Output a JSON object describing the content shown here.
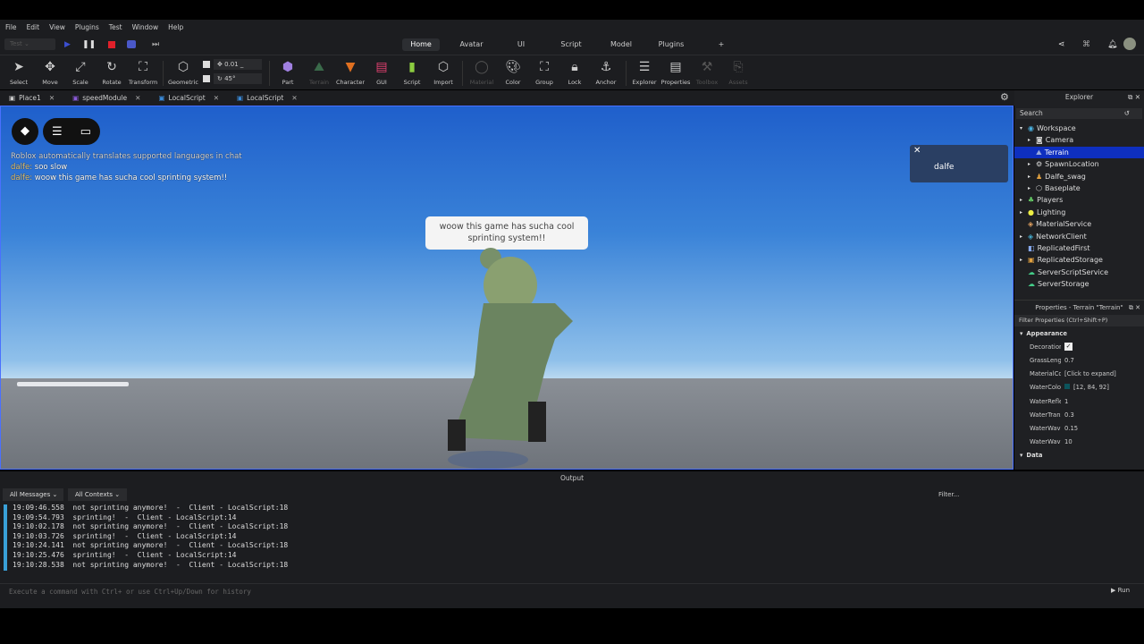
{
  "menu": [
    "File",
    "Edit",
    "View",
    "Plugins",
    "Test",
    "Window",
    "Help"
  ],
  "test_select": "Test",
  "top_tabs": [
    {
      "label": "Home",
      "active": true
    },
    {
      "label": "Avatar"
    },
    {
      "label": "UI"
    },
    {
      "label": "Script"
    },
    {
      "label": "Model"
    },
    {
      "label": "Plugins"
    },
    {
      "label": "+"
    }
  ],
  "ribbon": {
    "select": "Select",
    "move": "Move",
    "scale": "Scale",
    "rotate": "Rotate",
    "transform": "Transform",
    "geometric": "Geometric",
    "move_step": "0.01 _",
    "rotate_step": "45°",
    "part": "Part",
    "terrain": "Terrain",
    "character": "Character",
    "gui": "GUI",
    "script": "Script",
    "import": "Import",
    "material": "Material",
    "color": "Color",
    "group": "Group",
    "lock": "Lock",
    "anchor": "Anchor",
    "explorer": "Explorer",
    "properties": "Properties",
    "toolbox": "Toolbox",
    "assets": "Assets"
  },
  "doc_tabs": [
    "Place1",
    "speedModule",
    "LocalScript",
    "LocalScript"
  ],
  "viewport": {
    "chat": {
      "system": "Roblox automatically translates supported languages in chat",
      "messages": [
        {
          "user": "dalfe:",
          "text": "soo slow"
        },
        {
          "user": "dalfe:",
          "text": "woow this game has sucha cool sprinting system!!"
        }
      ]
    },
    "bubble": "woow this game has sucha cool sprinting system!!",
    "player_popup": "dalfe"
  },
  "explorer": {
    "title": "Explorer",
    "search_placeholder": "Search",
    "items": [
      {
        "label": "Workspace",
        "depth": 0,
        "icon": "globe-icon"
      },
      {
        "label": "Camera",
        "depth": 1,
        "icon": "camera-icon"
      },
      {
        "label": "Terrain",
        "depth": 1,
        "icon": "terrain-icon",
        "selected": true
      },
      {
        "label": "SpawnLocation",
        "depth": 1,
        "icon": "gear-icon"
      },
      {
        "label": "Dalfe_swag",
        "depth": 1,
        "icon": "model-icon"
      },
      {
        "label": "Baseplate",
        "depth": 1,
        "icon": "part-icon"
      },
      {
        "label": "Players",
        "depth": 0,
        "icon": "players-icon"
      },
      {
        "label": "Lighting",
        "depth": 0,
        "icon": "bulb-icon"
      },
      {
        "label": "MaterialService",
        "depth": 0,
        "icon": "service-icon"
      },
      {
        "label": "NetworkClient",
        "depth": 0,
        "icon": "network-icon"
      },
      {
        "label": "ReplicatedFirst",
        "depth": 0,
        "icon": "replicated-icon"
      },
      {
        "label": "ReplicatedStorage",
        "depth": 0,
        "icon": "storage-icon"
      },
      {
        "label": "ServerScriptService",
        "depth": 0,
        "icon": "server-icon"
      },
      {
        "label": "ServerStorage",
        "depth": 0,
        "icon": "server-icon"
      }
    ]
  },
  "properties": {
    "title": "Properties - Terrain \"Terrain\"",
    "filter": "Filter Properties (Ctrl+Shift+P)",
    "section": "Appearance",
    "section2": "Data",
    "rows": [
      {
        "name": "Decoration",
        "value": "",
        "checkbox": true
      },
      {
        "name": "GrassLength",
        "value": "0.7"
      },
      {
        "name": "MaterialCol...",
        "value": "[Click to expand]"
      },
      {
        "name": "WaterColor",
        "value": "[12, 84, 92]",
        "swatch": "#0c545c"
      },
      {
        "name": "WaterRefle...",
        "value": "1"
      },
      {
        "name": "WaterTrans...",
        "value": "0.3"
      },
      {
        "name": "WaterWave...",
        "value": "0.15"
      },
      {
        "name": "WaterWave...",
        "value": "10"
      }
    ]
  },
  "output": {
    "title": "Output",
    "filter_messages": "All Messages",
    "filter_contexts": "All Contexts",
    "filter_placeholder": "Filter...",
    "lines": [
      "19:09:46.558  not sprinting anymore!  -  Client - LocalScript:18",
      "19:09:54.793  sprinting!  -  Client - LocalScript:14",
      "19:10:02.178  not sprinting anymore!  -  Client - LocalScript:18",
      "19:10:03.726  sprinting!  -  Client - LocalScript:14",
      "19:10:24.141  not sprinting anymore!  -  Client - LocalScript:18",
      "19:10:25.476  sprinting!  -  Client - LocalScript:14",
      "19:10:28.538  not sprinting anymore!  -  Client - LocalScript:18"
    ],
    "command_placeholder": "Execute a command with Ctrl+ or use Ctrl+Up/Down for history",
    "run": "Run"
  }
}
